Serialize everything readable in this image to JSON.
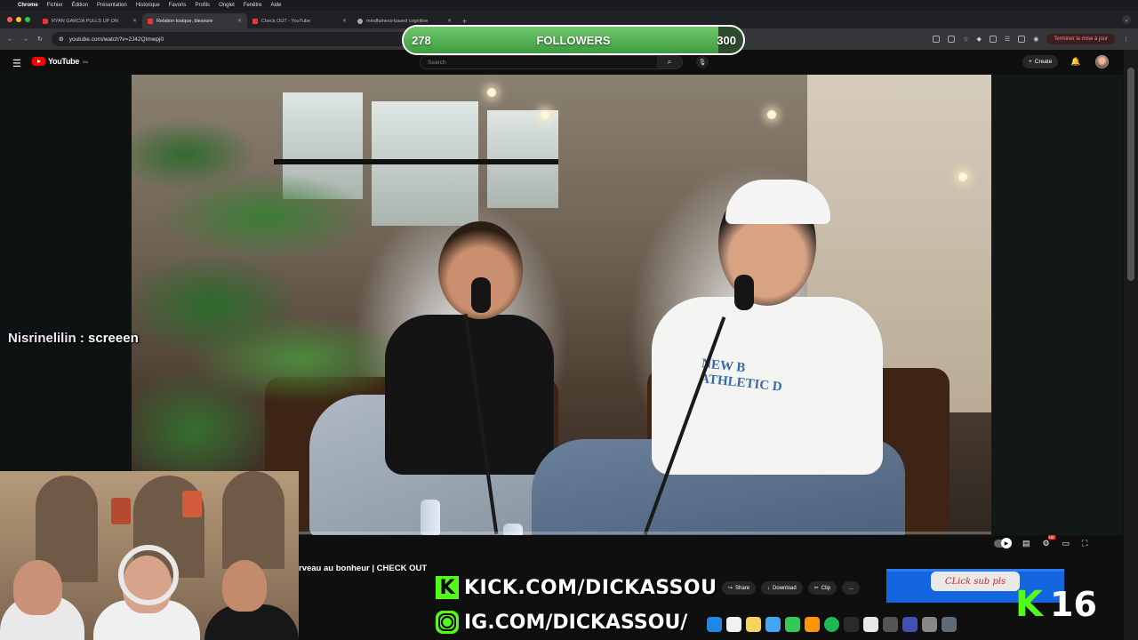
{
  "menubar": {
    "items": [
      "Chrome",
      "Fichier",
      "Édition",
      "Présentation",
      "Historique",
      "Favoris",
      "Profils",
      "Onglet",
      "Fenêtre",
      "Aide"
    ]
  },
  "tabs": [
    {
      "title": "RYAN GARCIA PULLS UP ON",
      "active": false
    },
    {
      "title": "Relation toxique, blessure",
      "active": true
    },
    {
      "title": "Check OUT - YouTube",
      "active": false
    },
    {
      "title": "mindfulness-based cognitive",
      "active": false
    }
  ],
  "address": {
    "url": "youtube.com/watch?v=2J42QImwpj0",
    "update_button": "Terminer la mise à jour"
  },
  "youtube": {
    "logo_text": "YouTube",
    "region": "MA",
    "search_placeholder": "Search",
    "create_label": "Create",
    "video_title": "rveau au bonheur | CHECK OUT",
    "actions": {
      "share": "Share",
      "download": "Download",
      "clip": "Clip",
      "more": "…"
    }
  },
  "followers_goal": {
    "current": "278",
    "label": "FOLLOWERS",
    "target": "300",
    "progress": 0.927
  },
  "chat": {
    "user": "Nisrinelilin",
    "separator": " : ",
    "message": "screeen"
  },
  "overlays": {
    "kick_url": "KICK.COM/DICKASSOU",
    "ig_url": "IG.COM/DICKASSOU/",
    "kick_glyph": "K",
    "sub_bubble": "CLick sub pls",
    "sub_count": "16"
  },
  "video_scene": {
    "shirt_text": "NEW B\nATHLETIC D"
  },
  "colors": {
    "kick_green": "#53fc18",
    "youtube_red": "#ff0000",
    "progress_green": "#4caf50"
  }
}
